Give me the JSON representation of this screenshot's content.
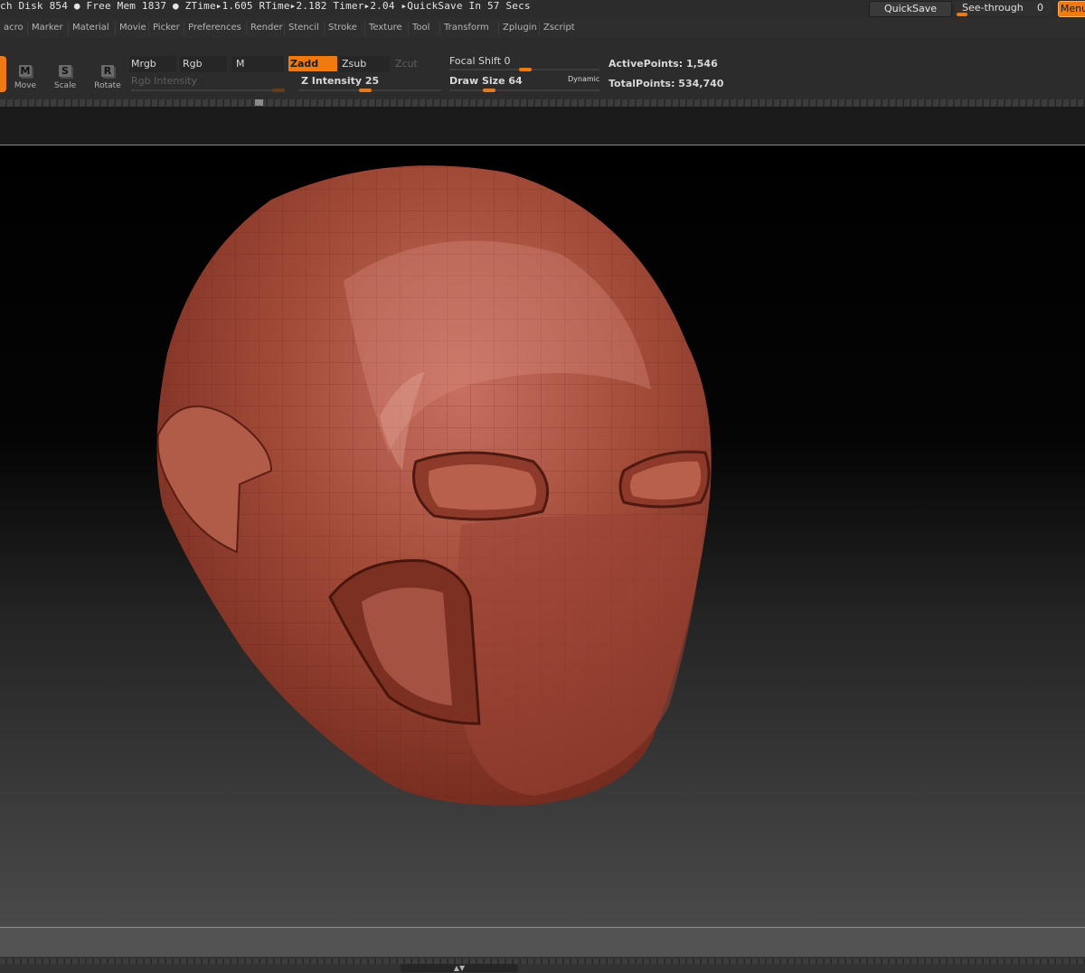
{
  "status": {
    "text": "ch Disk 854 ● Free Mem 1837 ● ZTime▸1.605 RTime▸2.182 Timer▸2.04 ▸QuickSave In 57 Secs"
  },
  "top_buttons": {
    "quicksave": "QuickSave",
    "seethrough": "See-through",
    "seethrough_value": "0",
    "menus": "Menu"
  },
  "menus": [
    "acro",
    "Marker",
    "Material",
    "Movie",
    "Picker",
    "Preferences",
    "Render",
    "Stencil",
    "Stroke",
    "Texture",
    "Tool",
    "Transform",
    "Zplugin",
    "Zscript"
  ],
  "tools": {
    "move": {
      "letter": "M",
      "label": "Move"
    },
    "scale": {
      "letter": "S",
      "label": "Scale"
    },
    "rotate": {
      "letter": "R",
      "label": "Rotate"
    }
  },
  "color_mode": {
    "mrgb": "Mrgb",
    "rgb": "Rgb",
    "m": "M",
    "rgb_intensity": "Rgb Intensity"
  },
  "sculpt_mode": {
    "zadd": "Zadd",
    "zsub": "Zsub",
    "zcut": "Zcut",
    "z_intensity": "Z Intensity 25"
  },
  "brush": {
    "focal_shift": "Focal Shift 0",
    "draw_size": "Draw Size 64",
    "dynamic": "Dynamic"
  },
  "stats": {
    "active_points": "ActivePoints: 1,546",
    "total_points": "TotalPoints: 534,740"
  },
  "colors": {
    "accent": "#f07a10",
    "model": "#9a4030"
  },
  "sliders": {
    "z_intensity_fraction": 0.25,
    "focal_shift_value": 0
  },
  "icons": {
    "collapse": "up-down-arrows-icon"
  }
}
